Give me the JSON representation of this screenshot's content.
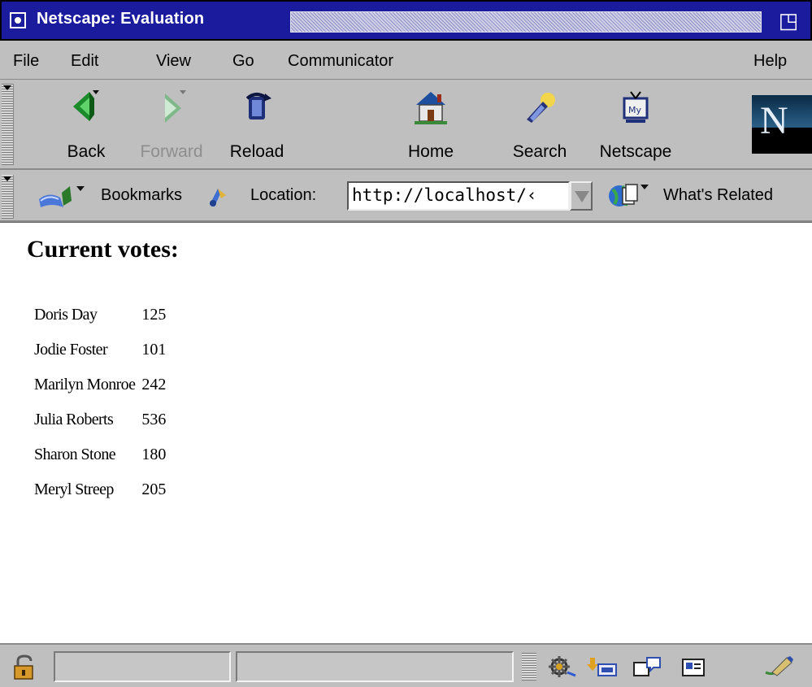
{
  "window": {
    "title": "Netscape: Evaluation"
  },
  "menu": {
    "items": [
      "File",
      "Edit",
      "View",
      "Go",
      "Communicator"
    ],
    "help": "Help"
  },
  "toolbar": {
    "buttons": [
      {
        "label": "Back",
        "icon": "back-arrow-icon",
        "enabled": true
      },
      {
        "label": "Forward",
        "icon": "forward-arrow-icon",
        "enabled": false
      },
      {
        "label": "Reload",
        "icon": "reload-icon",
        "enabled": true
      },
      {
        "label": "Home",
        "icon": "home-icon",
        "enabled": true
      },
      {
        "label": "Search",
        "icon": "search-icon",
        "enabled": true
      },
      {
        "label": "Netscape",
        "icon": "my-netscape-icon",
        "enabled": true
      }
    ],
    "logo": "N"
  },
  "location_bar": {
    "bookmarks_label": "Bookmarks",
    "location_label": "Location:",
    "url": "http://localhost/‹",
    "related_label": "What's Related"
  },
  "page": {
    "heading": "Current votes:",
    "votes": [
      {
        "name": "Doris Day",
        "count": "125"
      },
      {
        "name": "Jodie Foster",
        "count": "101"
      },
      {
        "name": "Marilyn Monroe",
        "count": "242"
      },
      {
        "name": "Julia Roberts",
        "count": "536"
      },
      {
        "name": "Sharon Stone",
        "count": "180"
      },
      {
        "name": "Meryl Streep",
        "count": "205"
      }
    ]
  },
  "statusbar": {
    "status_text": "",
    "progress_text": "",
    "components": [
      "navigator-icon",
      "mail-icon",
      "newsgroups-icon",
      "address-book-icon",
      "composer-icon"
    ]
  },
  "colors": {
    "titlebar": "#1b1b9d",
    "chrome": "#bfbfbf",
    "content_bg": "#ffffff",
    "disabled_text": "#8e8e8e"
  }
}
